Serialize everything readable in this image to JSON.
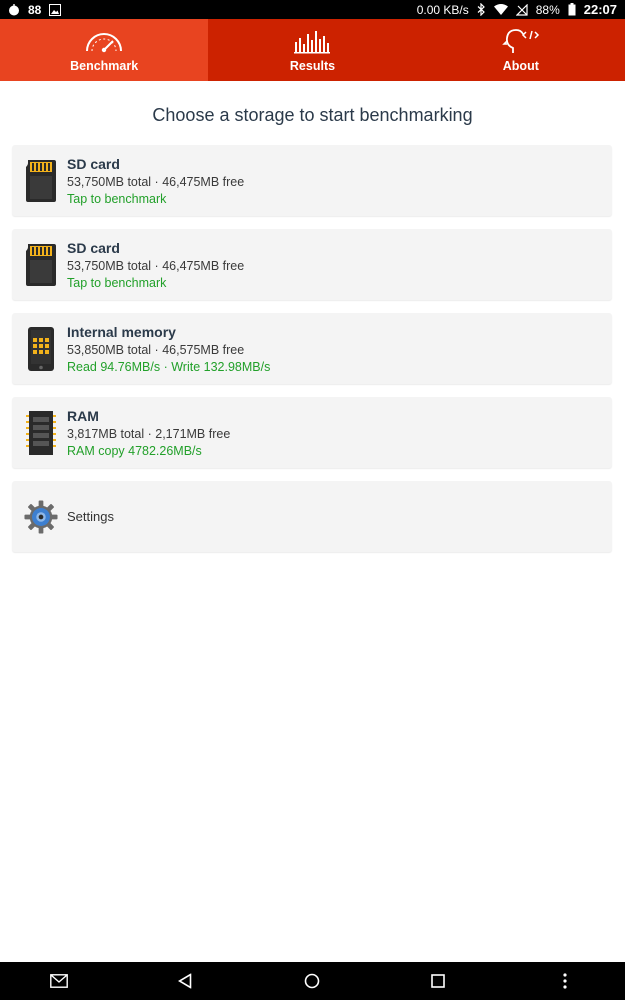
{
  "status_bar": {
    "notification_count": "88",
    "net_speed": "0.00 KB/s",
    "battery": "88%",
    "time": "22:07"
  },
  "tabs": [
    {
      "label": "Benchmark",
      "icon": "speedometer-icon",
      "active": true
    },
    {
      "label": "Results",
      "icon": "bar-chart-icon",
      "active": false
    },
    {
      "label": "About",
      "icon": "head-code-icon",
      "active": false
    }
  ],
  "heading": "Choose a storage to start benchmarking",
  "storages": [
    {
      "title": "SD card",
      "details": "53,750MB total · 46,475MB free",
      "status": "Tap to benchmark",
      "icon": "sd-card-icon"
    },
    {
      "title": "SD card",
      "details": "53,750MB total · 46,475MB free",
      "status": "Tap to benchmark",
      "icon": "sd-card-icon"
    },
    {
      "title": "Internal memory",
      "details": "53,850MB total · 46,575MB free",
      "status": "Read 94.76MB/s · Write 132.98MB/s",
      "icon": "phone-memory-icon"
    },
    {
      "title": "RAM",
      "details": "3,817MB total · 2,171MB free",
      "status": "RAM copy 4782.26MB/s",
      "icon": "ram-chip-icon"
    }
  ],
  "settings": {
    "label": "Settings",
    "icon": "gear-icon"
  },
  "colors": {
    "tab_bar": "#cc2200",
    "tab_active": "#e84420",
    "status_green": "#22a02a",
    "title_text": "#2b3a4a"
  }
}
